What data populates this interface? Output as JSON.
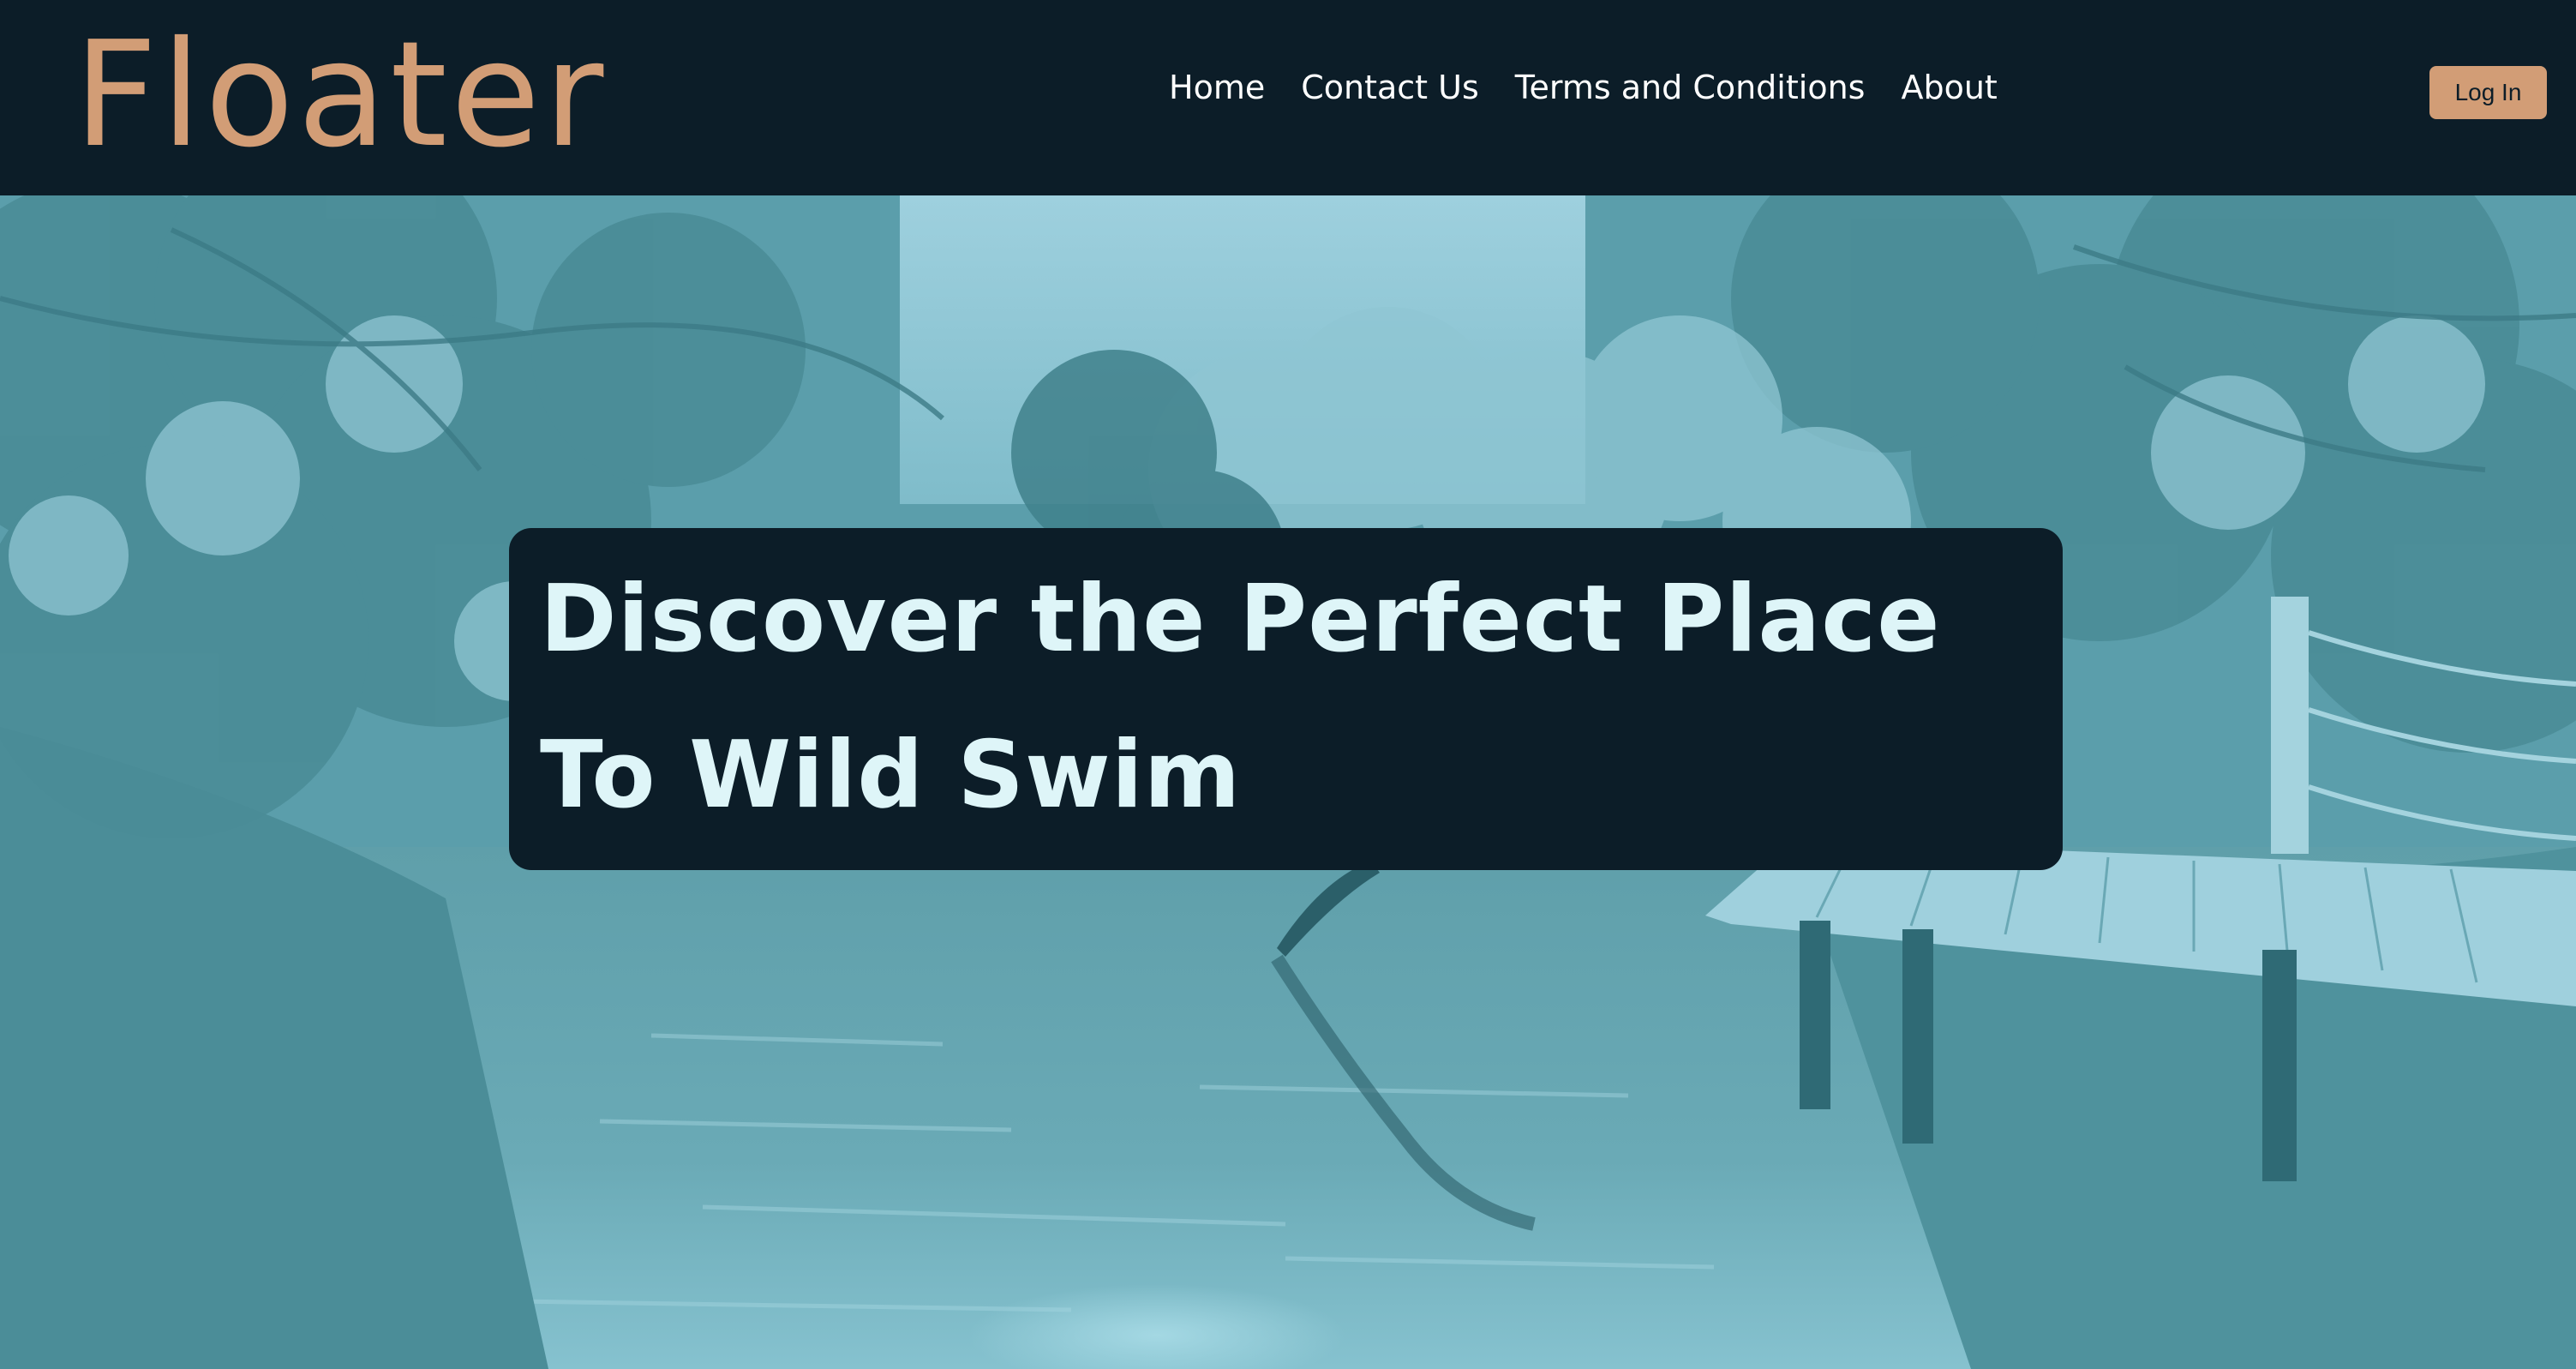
{
  "header": {
    "logo": "Floater",
    "nav": [
      {
        "label": "Home"
      },
      {
        "label": "Contact Us"
      },
      {
        "label": "Terms and Conditions"
      },
      {
        "label": "About"
      }
    ],
    "login_label": "Log In"
  },
  "hero": {
    "title": "Discover the Perfect Place To Wild Swim",
    "background_image": "river-with-trees-and-wooden-dock"
  },
  "colors": {
    "header_bg": "#0c1d28",
    "accent": "#d29d76",
    "hero_tint": "#5b9eab",
    "hero_title": "#def5f8",
    "nav_text": "#ffffff"
  }
}
